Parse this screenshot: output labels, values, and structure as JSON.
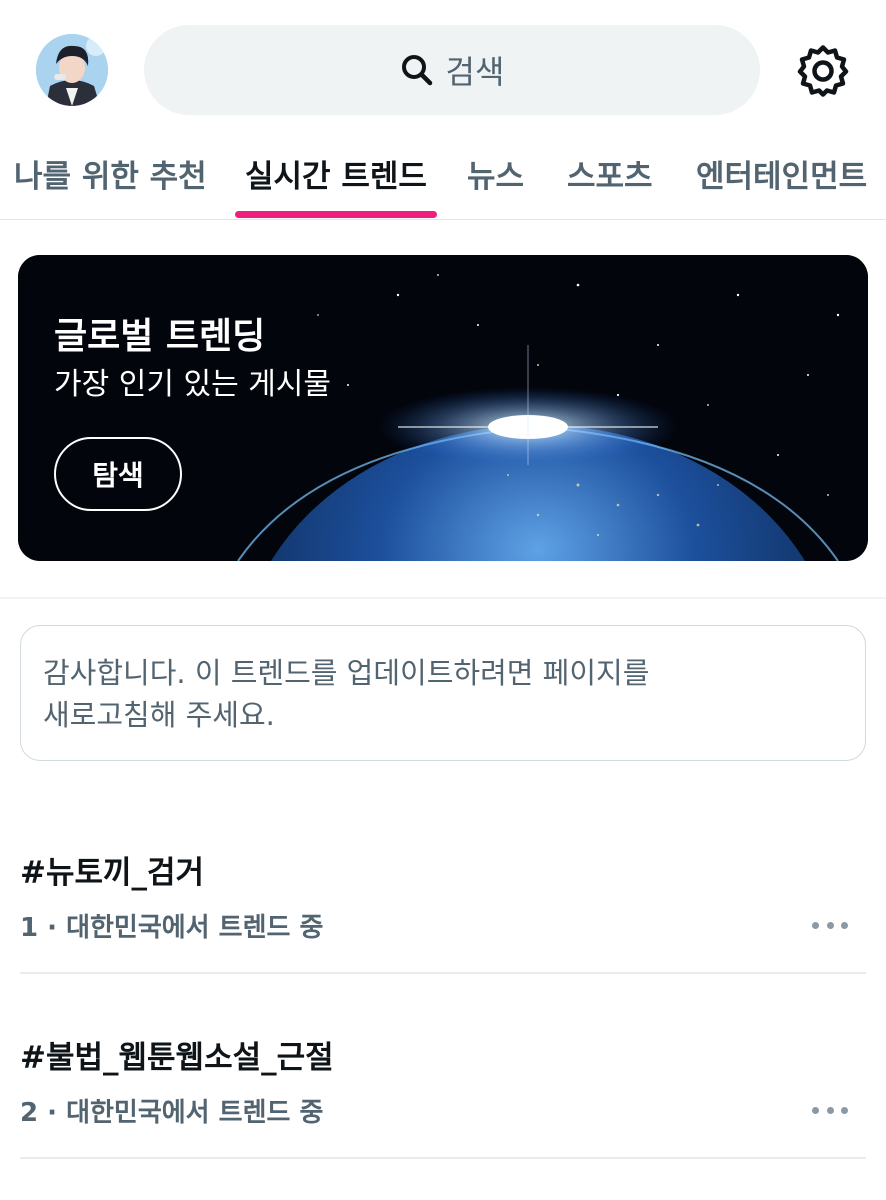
{
  "search": {
    "label": "검색"
  },
  "tabs": [
    {
      "label": "나를 위한 추천"
    },
    {
      "label": "실시간 트렌드"
    },
    {
      "label": "뉴스"
    },
    {
      "label": "스포츠"
    },
    {
      "label": "엔터테인먼트"
    }
  ],
  "active_tab": "실시간 트렌드",
  "banner": {
    "title": "글로벌 트렌딩",
    "subtitle": "가장 인기 있는 게시물",
    "button_label": "탐색"
  },
  "notice": {
    "line1": "감사합니다. 이 트렌드를 업데이트하려면 페이지를",
    "line2": "새로고침해 주세요."
  },
  "trends": [
    {
      "name": "#뉴토끼_검거",
      "meta": "1 · 대한민국에서 트렌드 중"
    },
    {
      "name": "#불법_웹툰웹소설_근절",
      "meta": "2 · 대한민국에서 트렌드 중"
    }
  ],
  "colors": {
    "accent": "#f01f7e",
    "text_primary": "#0f1419",
    "text_secondary": "#536471",
    "search_bg": "#eff3f4"
  },
  "icons": {
    "search": "search-icon",
    "settings": "gear-icon",
    "more": "more-icon",
    "avatar": "avatar"
  }
}
